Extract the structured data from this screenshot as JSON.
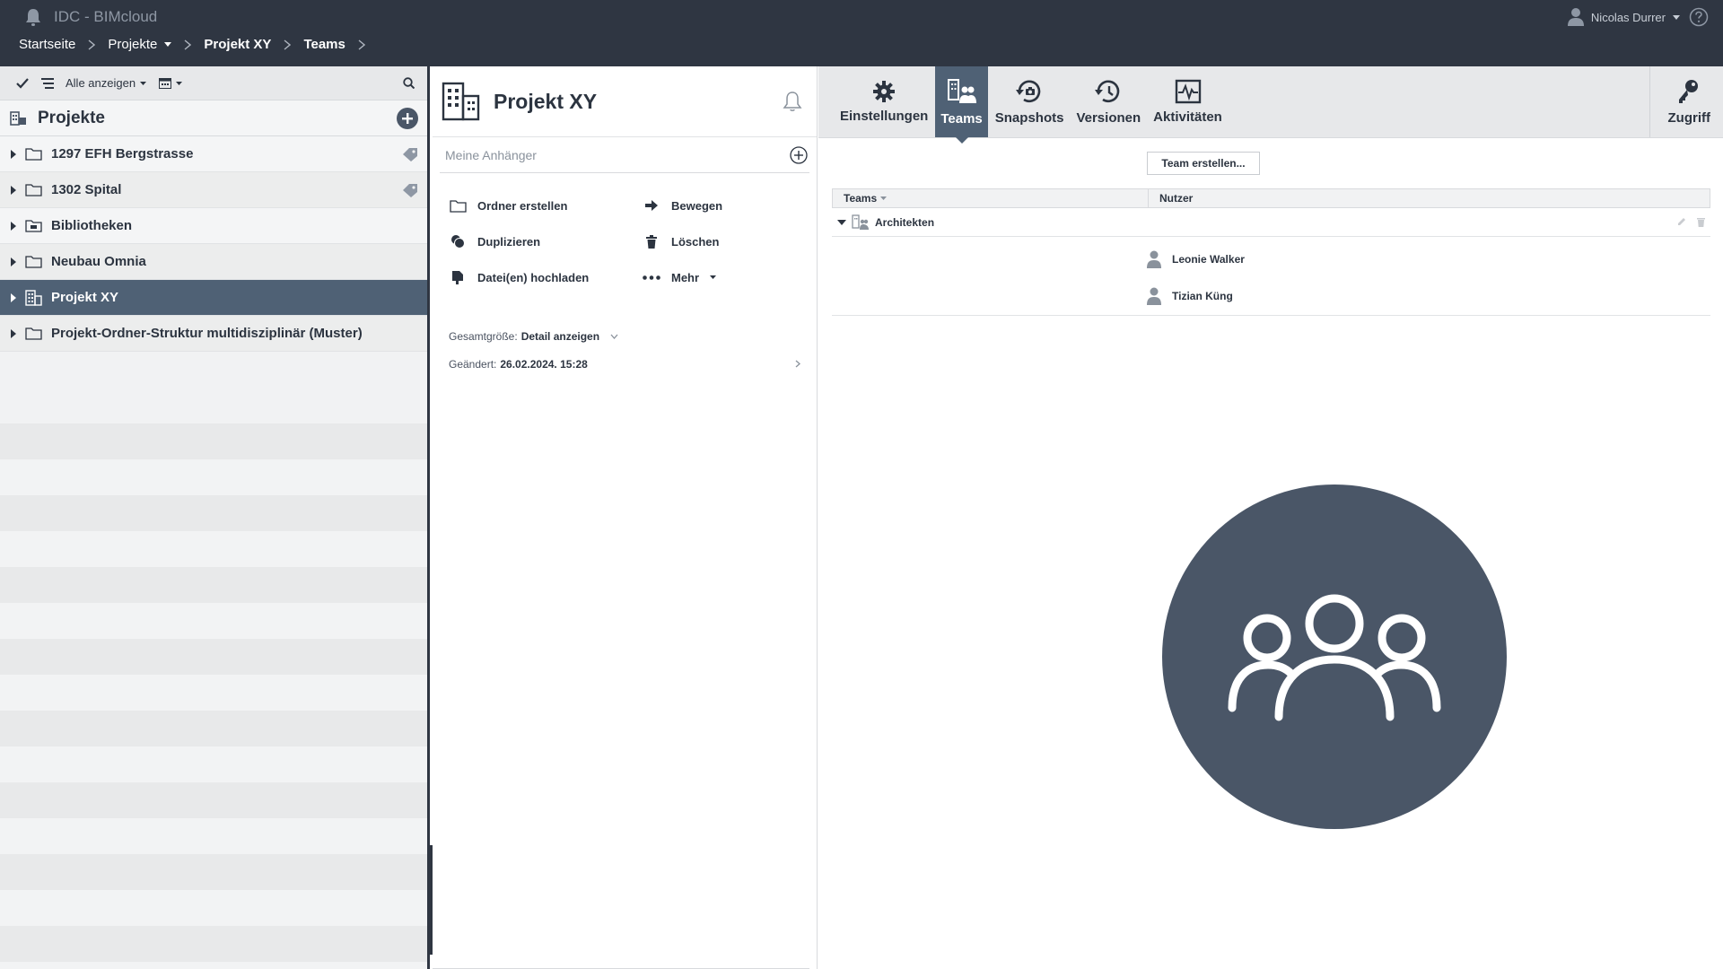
{
  "app": {
    "title": "IDC - BIMcloud"
  },
  "breadcrumb": [
    {
      "label": "Startseite"
    },
    {
      "label": "Projekte"
    },
    {
      "label": "Projekt XY"
    },
    {
      "label": "Teams"
    }
  ],
  "user": {
    "name": "Nicolas Durrer"
  },
  "left": {
    "filter_label": "Alle anzeigen",
    "header": "Projekte",
    "items": [
      {
        "label": "1297 EFH Bergstrasse",
        "icon": "folder-icon",
        "tag": true
      },
      {
        "label": "1302 Spital",
        "icon": "folder-icon",
        "tag": true
      },
      {
        "label": "Bibliotheken",
        "icon": "library-folder-icon",
        "tag": false
      },
      {
        "label": "Neubau Omnia",
        "icon": "folder-icon",
        "tag": false
      },
      {
        "label": "Projekt XY",
        "icon": "building-icon",
        "tag": false,
        "selected": true
      },
      {
        "label": "Projekt-Ordner-Struktur multidisziplinär (Muster)",
        "icon": "folder-icon",
        "tag": false
      }
    ]
  },
  "middle": {
    "title": "Projekt XY",
    "attachments_label": "Meine Anhänger",
    "actions": {
      "create_folder": "Ordner erstellen",
      "move": "Bewegen",
      "duplicate": "Duplizieren",
      "delete": "Löschen",
      "upload": "Datei(en) hochladen",
      "more": "Mehr"
    },
    "info": {
      "size_label": "Gesamtgröße:",
      "size_value": "Detail anzeigen",
      "changed_label": "Geändert:",
      "changed_value": "26.02.2024. 15:28"
    }
  },
  "ribbon": {
    "tabs": [
      {
        "label": "Einstellungen"
      },
      {
        "label": "Teams"
      },
      {
        "label": "Snapshots"
      },
      {
        "label": "Versionen"
      },
      {
        "label": "Aktivitäten"
      }
    ],
    "access": "Zugriff"
  },
  "teams": {
    "create_button": "Team erstellen...",
    "col_teams": "Teams",
    "col_users": "Nutzer",
    "team_name": "Architekten",
    "members": [
      "Leonie Walker",
      "Tizian Küng"
    ]
  },
  "colors": {
    "topbar": "#2f3642",
    "accent": "#4f6175",
    "circle": "#4a5667"
  }
}
